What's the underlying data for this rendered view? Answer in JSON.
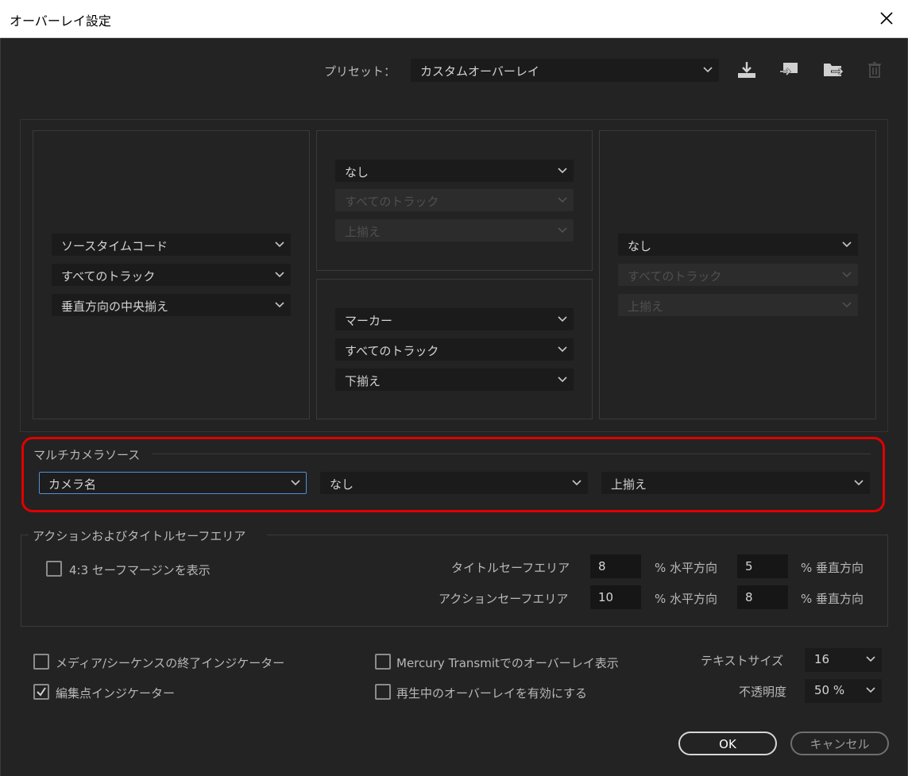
{
  "window": {
    "title": "オーバーレイ設定"
  },
  "preset": {
    "label": "プリセット：",
    "value": "カスタムオーバーレイ",
    "icons": [
      "save-preset-icon",
      "import-preset-icon",
      "export-preset-icon",
      "delete-preset-icon"
    ]
  },
  "layout": {
    "left": {
      "source": "ソースタイムコード",
      "track": "すべてのトラック",
      "align": "垂直方向の中央揃え"
    },
    "center_top": {
      "source": "なし",
      "track": "すべてのトラック",
      "align": "上揃え"
    },
    "center_bottom": {
      "source": "マーカー",
      "track": "すべてのトラック",
      "align": "下揃え"
    },
    "right": {
      "source": "なし",
      "track": "すべてのトラック",
      "align": "上揃え"
    }
  },
  "multicam": {
    "title": "マルチカメラソース",
    "source": "カメラ名",
    "track": "なし",
    "align": "上揃え"
  },
  "safe_area": {
    "title": "アクションおよびタイトルセーフエリア",
    "show_43_label": "4:3 セーフマージンを表示",
    "show_43_checked": false,
    "title_safe_label": "タイトルセーフエリア",
    "title_safe_h": "8",
    "title_safe_v": "5",
    "action_safe_label": "アクションセーフエリア",
    "action_safe_h": "10",
    "action_safe_v": "8",
    "h_unit": "% 水平方向",
    "v_unit": "% 垂直方向"
  },
  "options": {
    "end_indicator_label": "メディア/シーケンスの終了インジケーター",
    "end_indicator_checked": false,
    "edit_point_label": "編集点インジケーター",
    "edit_point_checked": true,
    "mercury_label": "Mercury  Transmitでのオーバーレイ表示",
    "mercury_checked": false,
    "playback_label": "再生中のオーバーレイを有効にする",
    "playback_checked": false,
    "text_size_label": "テキストサイズ",
    "text_size": "16",
    "opacity_label": "不透明度",
    "opacity": "50 %"
  },
  "buttons": {
    "ok": "OK",
    "cancel": "キャンセル"
  },
  "colors": {
    "background": "#232323",
    "field": "#1b1b1b",
    "focus": "#4f90d9",
    "highlight": "#e00000"
  }
}
